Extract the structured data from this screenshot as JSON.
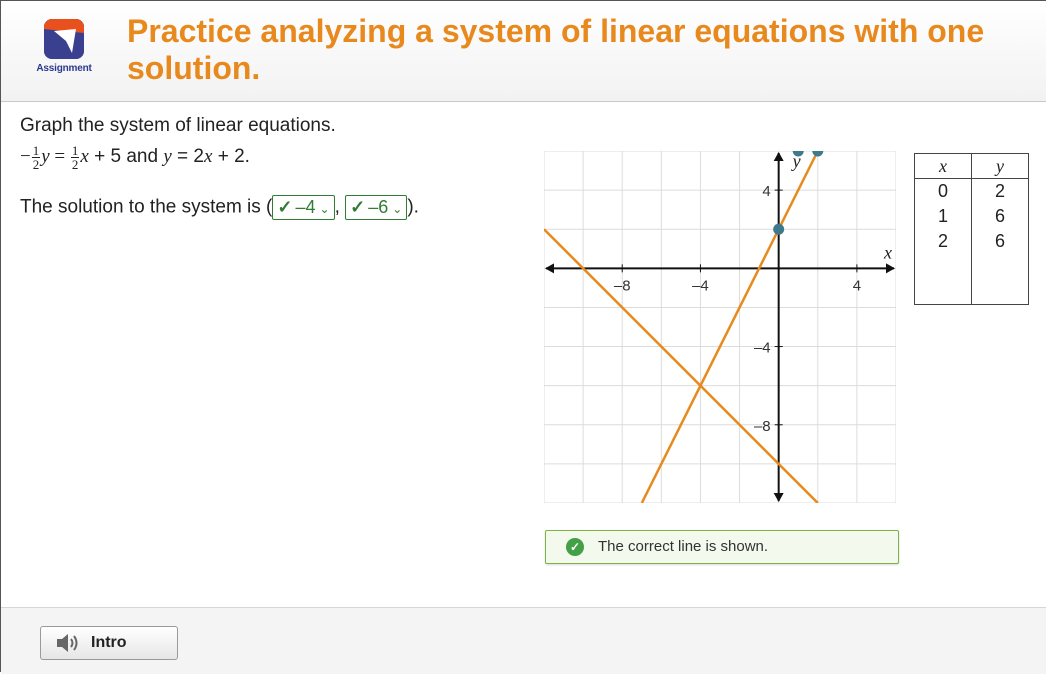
{
  "header": {
    "logo_caption": "Assignment",
    "title": "Practice analyzing a system of linear equations with one solution."
  },
  "question": {
    "instruction": "Graph the system of linear equations.",
    "eq_neg": "−",
    "eq_num": "1",
    "eq_den": "2",
    "eq_y": "y",
    "eq_equals": " = ",
    "eq_x": "x",
    "eq_plus5": " + 5",
    "eq_and": " and ",
    "eq2_y": "y",
    "eq2_rest": " = 2",
    "eq2_x": "x",
    "eq2_plus2": " + 2.",
    "solution_prefix": "The solution to the system is (",
    "answer_x": "–4",
    "comma": ",",
    "answer_y": "–6",
    "solution_suffix": ")."
  },
  "graph": {
    "xlabel": "x",
    "ylabel": "y",
    "xlim": [
      -12,
      6
    ],
    "ylim": [
      -12,
      6
    ],
    "tick_labels_x": [
      "–8",
      "–4",
      "4"
    ],
    "tick_labels_y": [
      "4",
      "–4",
      "–8"
    ],
    "line_color": "#e8891d",
    "point_color": "#3f7a8a",
    "lines": [
      {
        "slope": -1,
        "intercept": -10
      },
      {
        "slope": 2,
        "intercept": 2
      }
    ],
    "points": [
      {
        "x": 0,
        "y": 2
      },
      {
        "x": 1,
        "y": 6
      },
      {
        "x": 2,
        "y": 6
      }
    ]
  },
  "table": {
    "headers": [
      "x",
      "y"
    ],
    "rows": [
      [
        "0",
        "2"
      ],
      [
        "1",
        "6"
      ],
      [
        "2",
        "6"
      ]
    ]
  },
  "feedback": {
    "text": "The correct line is shown."
  },
  "footer": {
    "intro_label": "Intro"
  }
}
